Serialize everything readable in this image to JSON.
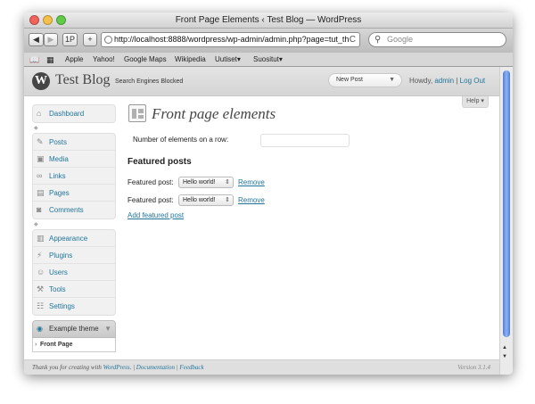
{
  "window": {
    "title": "Front Page Elements ‹ Test Blog — WordPress"
  },
  "toolbar": {
    "back": "◀",
    "forward": "▶",
    "onepassword": "1P",
    "add_bookmark": "+",
    "url": "http://localhost:8888/wordpress/wp-admin/admin.php?page=tut_th",
    "reload": "C",
    "search_placeholder": "Google"
  },
  "bookmarks": [
    "Apple",
    "Yahoo!",
    "Google Maps",
    "Wikipedia",
    "Uutiset▾",
    "Suosituт▾"
  ],
  "wp": {
    "site_title": "Test Blog",
    "seo": "Search Engines Blocked",
    "favorites": "New Post",
    "howdy": "Howdy,",
    "user": "admin",
    "logout": "Log Out",
    "help": "Help ▾"
  },
  "menu": {
    "group1": [
      "Dashboard"
    ],
    "group2": [
      "Posts",
      "Media",
      "Links",
      "Pages",
      "Comments"
    ],
    "group3": [
      "Appearance",
      "Plugins",
      "Users",
      "Tools",
      "Settings"
    ],
    "theme": "Example theme",
    "theme_sub": "Front Page"
  },
  "main": {
    "title": "Front page elements",
    "num_label": "Number of elements on a row:",
    "num_value": "",
    "featured_heading": "Featured posts",
    "featured": [
      {
        "label": "Featured post:",
        "value": "Hello world!",
        "remove": "Remove"
      },
      {
        "label": "Featured post:",
        "value": "Hello world!",
        "remove": "Remove"
      }
    ],
    "add_link": "Add featured post"
  },
  "footer": {
    "thanks": "Thank you for creating with",
    "wp": "WordPress",
    "doc": "Documentation",
    "feedback": "Feedback",
    "version": "Version 3.1.4"
  }
}
